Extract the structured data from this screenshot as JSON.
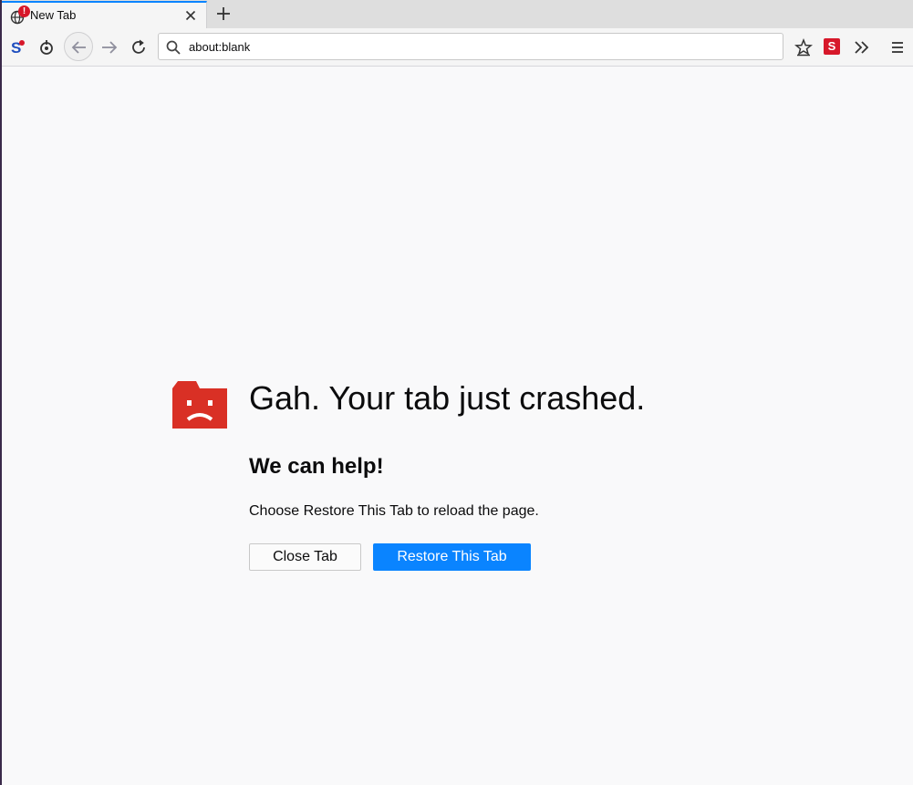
{
  "tabs": [
    {
      "title": "New Tab",
      "badge": "!"
    }
  ],
  "url": "about:blank",
  "crash": {
    "title": "Gah. Your tab just crashed.",
    "subtitle": "We can help!",
    "description": "Choose Restore This Tab to reload the page.",
    "close_button": "Close Tab",
    "restore_button": "Restore This Tab"
  },
  "toolbar": {
    "extension_badge": "S"
  },
  "icons": {
    "tab_favicon": "globe-icon",
    "tab_close": "close-icon",
    "new_tab": "plus-icon",
    "ext1": "s-extension-icon",
    "ext2": "sync-icon",
    "back": "back-arrow-icon",
    "forward": "forward-arrow-icon",
    "reload": "reload-icon",
    "search": "search-icon",
    "bookmarks": "bookmark-star-icon",
    "ext3": "s-red-extension-icon",
    "overflow": "chevron-double-right-icon",
    "menu": "hamburger-menu-icon",
    "crash": "sad-face-folder-icon"
  },
  "colors": {
    "accent": "#0a84ff",
    "crash_icon": "#d93025",
    "badge": "#d7182a"
  }
}
